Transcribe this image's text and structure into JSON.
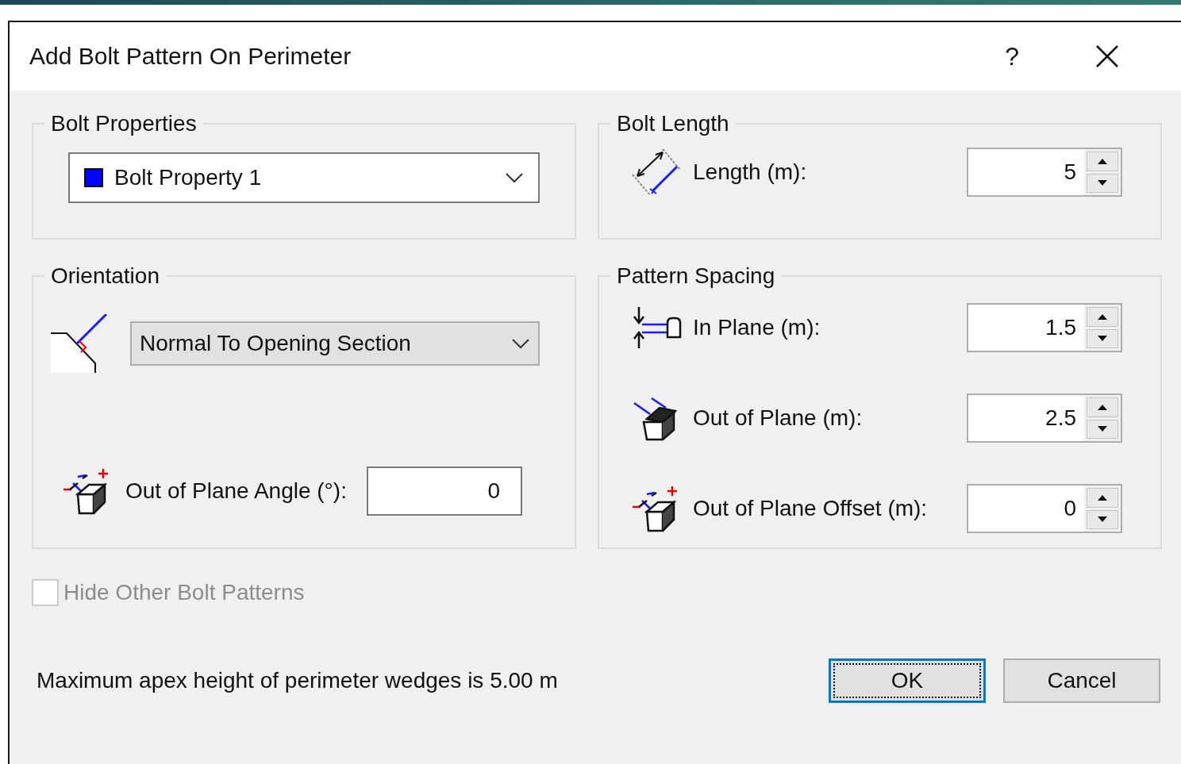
{
  "window": {
    "title": "Add Bolt Pattern On Perimeter",
    "help": "?"
  },
  "bolt_properties": {
    "title": "Bolt Properties",
    "dropdown": {
      "kind": "edit",
      "value": "Bolt Property 1",
      "color": "#0000ff"
    }
  },
  "orientation": {
    "title": "Orientation",
    "dropdown": {
      "kind": "list",
      "value": "Normal To Opening Section"
    },
    "angle": {
      "label": "Out of Plane Angle (°):",
      "value": "0"
    }
  },
  "bolt_length": {
    "title": "Bolt Length",
    "fields": [
      {
        "kind": "length",
        "label": "Length (m):",
        "value": "5"
      }
    ]
  },
  "pattern_spacing": {
    "title": "Pattern Spacing",
    "fields": [
      {
        "kind": "in_plane",
        "label": "In Plane (m):",
        "value": "1.5"
      },
      {
        "kind": "out_of_plane",
        "label": "Out of Plane (m):",
        "value": "2.5"
      },
      {
        "kind": "offset",
        "label": "Out of Plane Offset (m):",
        "value": "0"
      }
    ]
  },
  "hide_other": {
    "label": "Hide Other Bolt Patterns",
    "checked": false,
    "disabled": true
  },
  "message": "Maximum apex height of perimeter wedges is 5.00 m",
  "buttons": [
    {
      "label": "OK",
      "default": true
    },
    {
      "label": "Cancel",
      "default": false
    }
  ]
}
